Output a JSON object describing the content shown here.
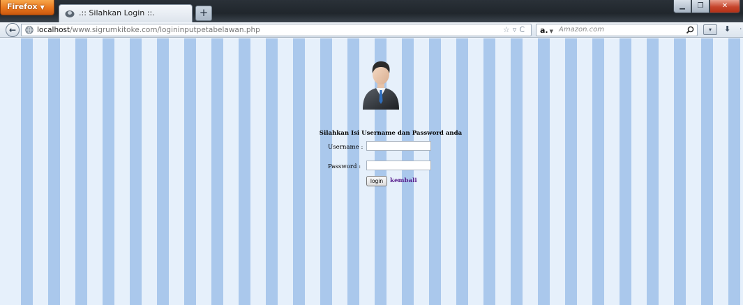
{
  "browser": {
    "menu_button": "Firefox",
    "tab_title": ".:: Silahkan Login ::.",
    "new_tab": "+",
    "url_host": "localhost",
    "url_path": "/www.sigrumkitoke.com/logininputpetabelawan.php",
    "search_engine": "a.",
    "search_placeholder": "Amazon.com"
  },
  "login": {
    "title": "Silahkan Isi Username dan Password anda",
    "username_label": "Username :",
    "password_label": "Password :",
    "username_value": "",
    "password_value": "",
    "submit_label": "login",
    "back_link": "kembali"
  },
  "colors": {
    "stripe_light": "#e6f0fb",
    "stripe_dark": "#aac8ec",
    "link_visited": "#551a8b",
    "firefox_orange": "#e8761d"
  }
}
